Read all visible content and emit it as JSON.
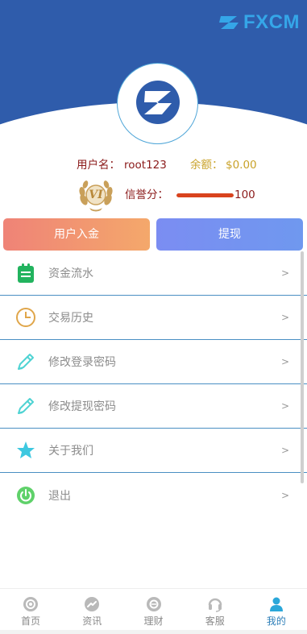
{
  "brand": {
    "name": "FXCM",
    "logo_icon": "fxcm-logo-icon"
  },
  "profile": {
    "avatar_icon": "fxcm-z-avatar-icon",
    "username_label": "用户名：",
    "username": "root123",
    "balance_label": "余额：",
    "balance": "$0.00",
    "vip_badge_text": "VI",
    "credit_label": "信誉分：",
    "credit_score": "100",
    "credit_fraction": 1.0
  },
  "actions": {
    "deposit_label": "用户入金",
    "withdraw_label": "提现"
  },
  "menu": [
    {
      "label": "资金流水",
      "icon": "clipboard-icon",
      "arrow": ">"
    },
    {
      "label": "交易历史",
      "icon": "clock-icon",
      "arrow": ">"
    },
    {
      "label": "修改登录密码",
      "icon": "pencil-icon",
      "arrow": ">"
    },
    {
      "label": "修改提现密码",
      "icon": "pencil-icon",
      "arrow": ">"
    },
    {
      "label": "关于我们",
      "icon": "star-icon",
      "arrow": ">"
    },
    {
      "label": "退出",
      "icon": "power-icon",
      "arrow": ">"
    }
  ],
  "tabbar": [
    {
      "label": "首页",
      "icon": "home-icon",
      "active": false
    },
    {
      "label": "资讯",
      "icon": "news-trend-icon",
      "active": false
    },
    {
      "label": "理财",
      "icon": "finance-icon",
      "active": false
    },
    {
      "label": "客服",
      "icon": "headset-icon",
      "active": false
    },
    {
      "label": "我的",
      "icon": "user-icon",
      "active": true
    }
  ],
  "colors": {
    "header_bg": "#2f5cab",
    "brand": "#35a6e8",
    "username": "#8b1a1a",
    "balance": "#c9a229",
    "credit_bar": "#d9431e",
    "tab_active": "#2e7fb8"
  }
}
